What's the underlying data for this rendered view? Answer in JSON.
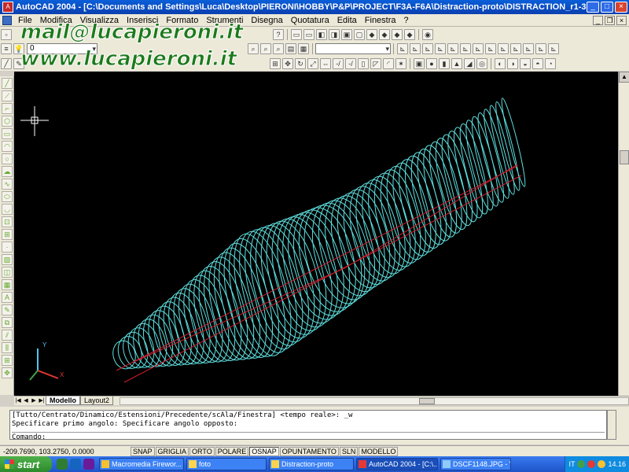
{
  "window": {
    "title": "AutoCAD 2004 - [C:\\Documents and Settings\\Luca\\Desktop\\PIERONI\\HOBBY\\P&P\\PROJECT\\F3A-F6A\\Distraction-proto\\DISTRACTION_r1-3d.dwg]",
    "minimize": "_",
    "maximize": "□",
    "close": "×"
  },
  "menu": [
    "File",
    "Modifica",
    "Visualizza",
    "Inserisci",
    "Formato",
    "Strumenti",
    "Disegna",
    "Quotatura",
    "Edita",
    "Finestra",
    "?"
  ],
  "toolbar": {
    "layer_value": "0"
  },
  "watermark": {
    "line1": "mail@lucapieroni.it",
    "line2": "www.lucapieroni.it"
  },
  "tabs": {
    "model": "Modello",
    "layout": "Layout2"
  },
  "command": {
    "line1": "[Tutto/Centrato/Dinamico/Estensioni/Precedente/scAla/Finestra] <tempo reale>: _w",
    "line2": "Specificare primo angolo: Specificare angolo opposto:",
    "prompt": "Comando:"
  },
  "status": {
    "coords": "-209.7690, 103.2750, 0.0000",
    "buttons": [
      {
        "label": "SNAP",
        "on": false
      },
      {
        "label": "GRIGLIA",
        "on": false
      },
      {
        "label": "ORTO",
        "on": false
      },
      {
        "label": "POLARE",
        "on": false
      },
      {
        "label": "OSNAP",
        "on": true
      },
      {
        "label": "OPUNTAMENTO",
        "on": false
      },
      {
        "label": "SLN",
        "on": false
      },
      {
        "label": "MODELLO",
        "on": false
      }
    ]
  },
  "ucs": {
    "x": "X",
    "y": "Y"
  },
  "taskbar": {
    "start": "start",
    "tasks": [
      {
        "label": "Macromedia Firewor...",
        "active": false
      },
      {
        "label": "foto",
        "active": false
      },
      {
        "label": "Distraction-proto",
        "active": false
      },
      {
        "label": "AutoCAD 2004 - [C:\\...",
        "active": true
      },
      {
        "label": "DSCF1148.JPG - Visu...",
        "active": false
      }
    ],
    "language": "IT",
    "clock": "14.16"
  },
  "colors": {
    "drawing_bg": "#000000",
    "fuselage_lines": "#5fe0e0",
    "outline_lines": "#d01c2a"
  }
}
